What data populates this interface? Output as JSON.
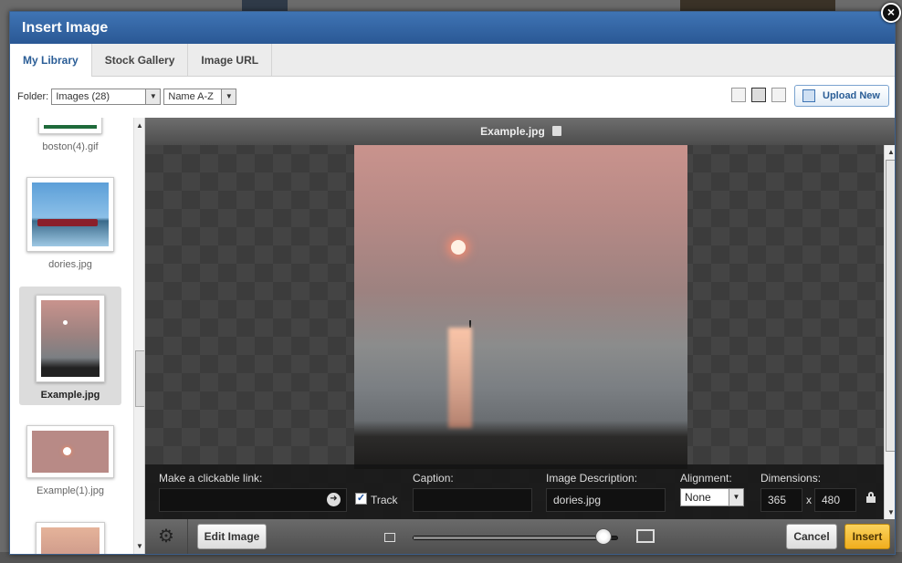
{
  "dialog": {
    "title": "Insert Image",
    "close_symbol": "×"
  },
  "tabs": [
    {
      "label": "My Library",
      "active": true
    },
    {
      "label": "Stock Gallery",
      "active": false
    },
    {
      "label": "Image URL",
      "active": false
    }
  ],
  "toolbar": {
    "folder_label": "Folder:",
    "folder_value": "Images (28)",
    "sort_value": "Name A-Z",
    "upload_label": "Upload New"
  },
  "thumbnails": [
    {
      "label": "boston(4).gif",
      "selected": false
    },
    {
      "label": "dories.jpg",
      "selected": false
    },
    {
      "label": "Example.jpg",
      "selected": true
    },
    {
      "label": "Example(1).jpg",
      "selected": false
    }
  ],
  "preview": {
    "file_name": "Example.jpg"
  },
  "properties": {
    "link_label": "Make a clickable link:",
    "link_value": "",
    "track_label": "Track",
    "track_checked": true,
    "caption_label": "Caption:",
    "caption_value": "",
    "description_label": "Image Description:",
    "description_value": "dories.jpg",
    "alignment_label": "Alignment:",
    "alignment_value": "None",
    "dimensions_label": "Dimensions:",
    "width": "365",
    "height": "480",
    "dim_separator": "x"
  },
  "footer": {
    "edit_label": "Edit Image",
    "cancel_label": "Cancel",
    "insert_label": "Insert",
    "zoom_fraction": 0.93
  },
  "colors": {
    "brand_blue": "#2a5895",
    "insert_gold": "#f0ae1e"
  }
}
